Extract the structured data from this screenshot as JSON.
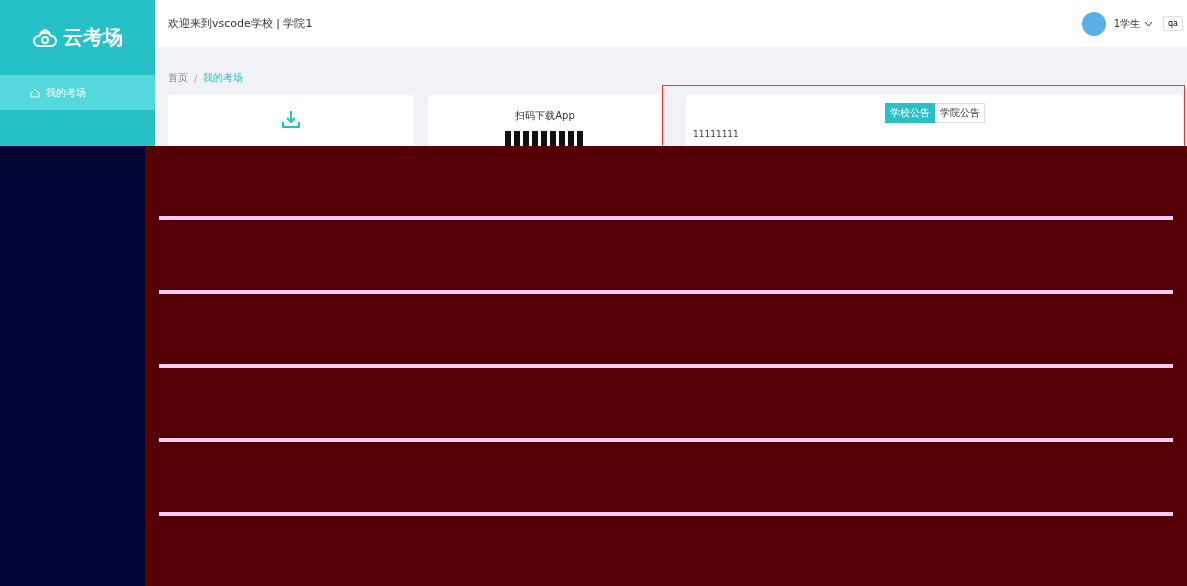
{
  "logo": {
    "text": "云考场"
  },
  "sidebar": {
    "items": [
      {
        "label": "我的考场",
        "selected": true
      }
    ]
  },
  "header": {
    "welcome": "欢迎来到vscode学校 | 学院1",
    "user": "1学生",
    "language": "qa"
  },
  "breadcrumb_separator": "/",
  "breadcrumb": [
    {
      "label": "首页",
      "selected": false
    },
    {
      "label": "我的考场",
      "selected": true
    }
  ],
  "app_card": {
    "title": "扫码下载App"
  },
  "notice": {
    "tabs": [
      {
        "label": "学校公告",
        "selected": true
      },
      {
        "label": "学院公告",
        "selected": false
      }
    ],
    "text": "11111111"
  }
}
